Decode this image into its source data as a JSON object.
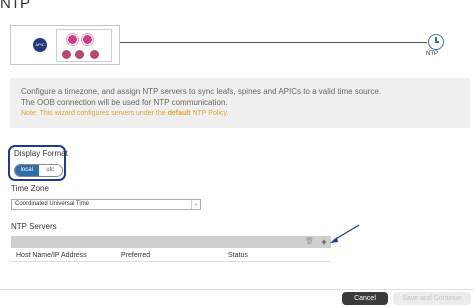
{
  "header": {
    "title": "NTP"
  },
  "diagram": {
    "apic_label": "APIC",
    "target_label": "NTP",
    "line_color": "#555555",
    "icon_color": "#3d6fa6"
  },
  "info": {
    "line1": "Configure a timezone, and assign NTP servers to sync leafs, spines and APICs to a valid time source.",
    "line2": "The OOB connection will be used for NTP communication.",
    "note_prefix": "Note: This wizard configures servers under the ",
    "note_bold": "default",
    "note_suffix": " NTP Policy.",
    "note_color": "#e8a230"
  },
  "display_format": {
    "label": "Display Format",
    "options": [
      "local",
      "utc"
    ],
    "selected": "local",
    "highlight_color": "#1d3c8a"
  },
  "time_zone": {
    "label": "Time Zone",
    "value": "Coordinated Universal Time"
  },
  "ntp_servers": {
    "label": "NTP Servers",
    "add_label": "+",
    "columns": [
      "Host Name/IP Address",
      "Preferred",
      "Status"
    ],
    "rows": []
  },
  "footer": {
    "cancel_label": "Cancel",
    "continue_label": "Save and Continue"
  }
}
